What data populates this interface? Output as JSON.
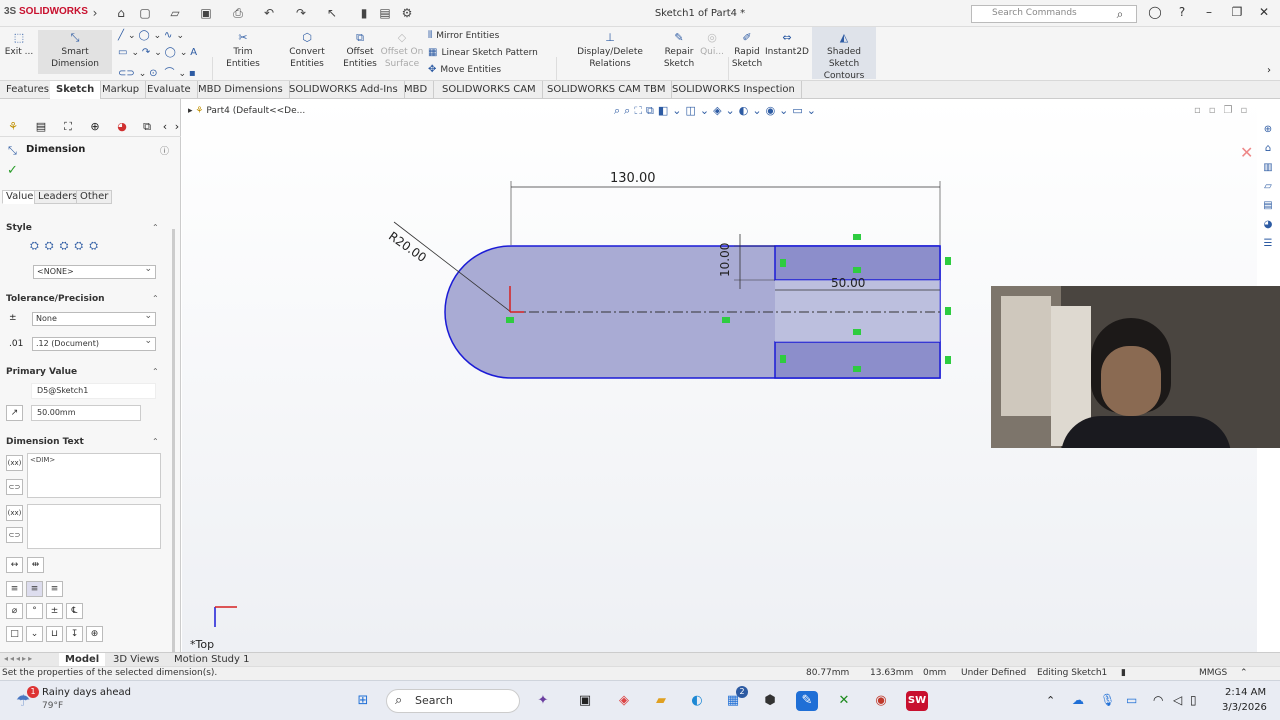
{
  "app": {
    "brand_a": "3S",
    "brand_b": "SOLIDWORKS",
    "title": "Sketch1 of Part4 *",
    "search_placeholder": "Search Commands"
  },
  "cmd": {
    "exit_sketch": "Exit ...",
    "smart_dimension": "Smart Dimension",
    "trim": "Trim Entities",
    "convert": "Convert Entities",
    "offset": "Offset Entities",
    "offset_surface": "Offset On Surface",
    "mirror": "Mirror Entities",
    "linear_pattern": "Linear Sketch Pattern",
    "move": "Move Entities",
    "display_relations": "Display/Delete Relations",
    "repair": "Repair Sketch",
    "quick": "Qui...",
    "rapid": "Rapid Sketch",
    "instant2d": "Instant2D",
    "shaded": "Shaded Sketch Contours"
  },
  "tabs": [
    "Features",
    "Sketch",
    "Markup",
    "Evaluate",
    "MBD Dimensions",
    "SOLIDWORKS Add-Ins",
    "MBD",
    "SOLIDWORKS CAM",
    "SOLIDWORKS CAM TBM",
    "SOLIDWORKS Inspection"
  ],
  "tree_path": "Part4  (Default<<De...",
  "panel": {
    "title": "Dimension",
    "subtabs": [
      "Value",
      "Leaders",
      "Other"
    ],
    "style_header": "Style",
    "style_value": "<NONE>",
    "tolerance_header": "Tolerance/Precision",
    "tolerance_value": "None",
    "precision_value": ".12 (Document)",
    "primary_header": "Primary Value",
    "primary_name": "D5@Sketch1",
    "primary_value": "50.00mm",
    "dimtext_header": "Dimension Text",
    "dimtext_value": "<DIM>"
  },
  "sketch": {
    "dim_overall": "130.00",
    "dim_radius": "R20.00",
    "dim_slot_width": "10.00",
    "dim_slot_length": "50.00",
    "view_label": "*Top"
  },
  "bottom_tabs": [
    "Model",
    "3D Views",
    "Motion Study 1"
  ],
  "status": {
    "hint": "Set the properties of the selected dimension(s).",
    "x": "80.77mm",
    "y": "13.63mm",
    "z": "0mm",
    "state": "Under Defined",
    "editing": "Editing Sketch1",
    "units": "MMGS"
  },
  "taskbar": {
    "weather_title": "Rainy days ahead",
    "weather_temp": "79°F",
    "search": "Search",
    "time": "2:14 AM",
    "date": "3/3/2026",
    "badge_weather": "1",
    "badge_store": "2"
  },
  "colors": {
    "accent": "#2d5ba3",
    "sketch_fill": "#a9abd4",
    "sketch_line": "#1b1bd6",
    "brand": "#c8102e"
  }
}
